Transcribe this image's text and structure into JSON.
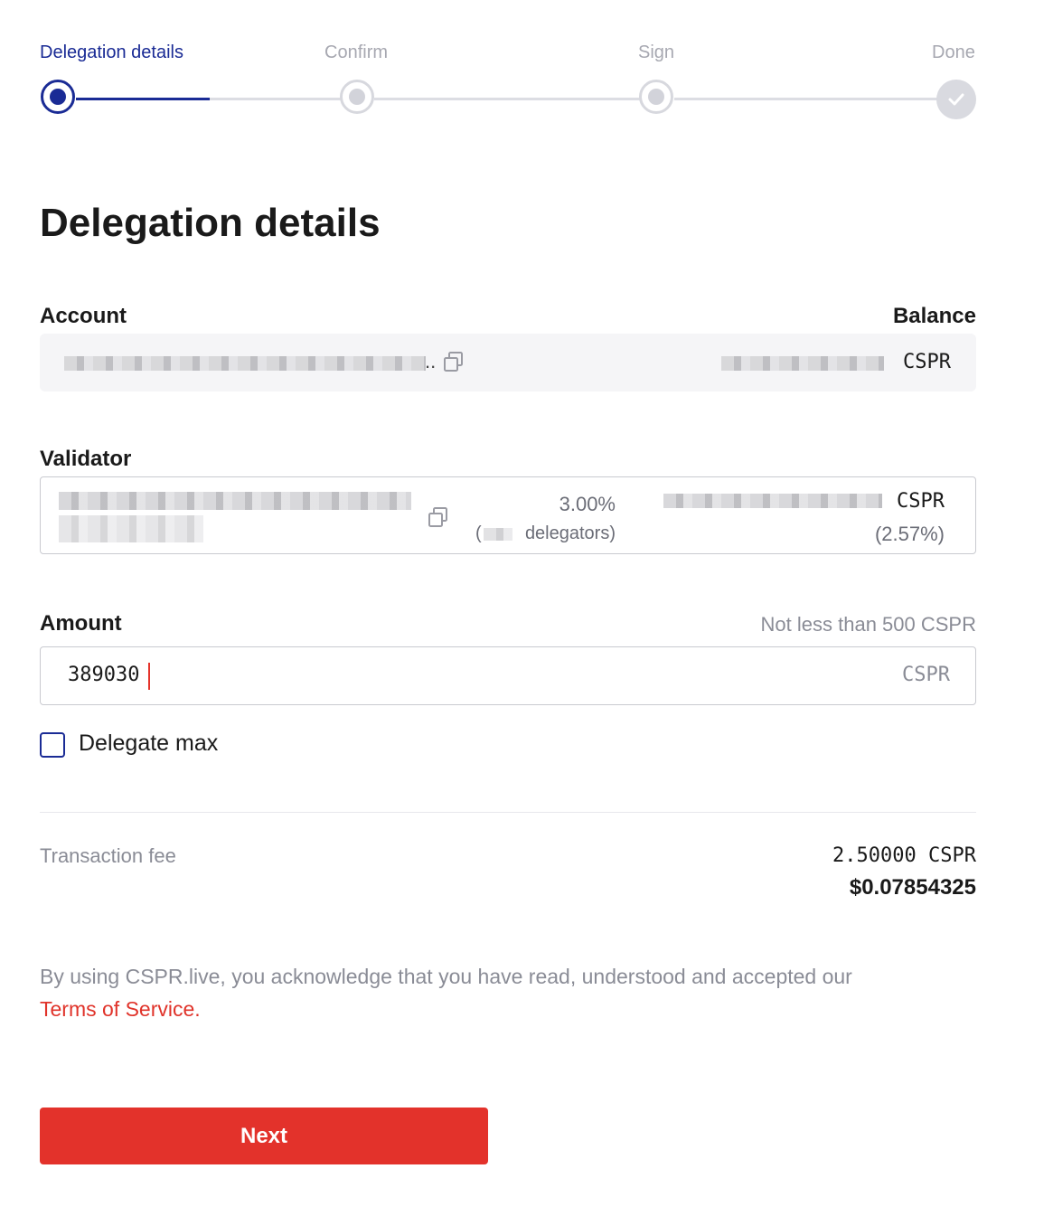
{
  "stepper": {
    "steps": [
      {
        "label": "Delegation details",
        "state": "current"
      },
      {
        "label": "Confirm",
        "state": "pending"
      },
      {
        "label": "Sign",
        "state": "pending"
      },
      {
        "label": "Done",
        "state": "pending"
      }
    ]
  },
  "page_title": "Delegation details",
  "account": {
    "label": "Account",
    "balance_label": "Balance",
    "address_suffix": "..",
    "balance_unit": "CSPR",
    "copy_icon": "copy-icon"
  },
  "validator": {
    "label": "Validator",
    "fee": "3.00%",
    "delegators_open": "(",
    "delegators_text": "delegators)",
    "stake_unit": "CSPR",
    "stake_share": "(2.57%)",
    "copy_icon": "copy-icon"
  },
  "amount": {
    "label": "Amount",
    "hint": "Not less than 500 CSPR",
    "value": "389030",
    "unit": "CSPR"
  },
  "delegate_max": {
    "label": "Delegate max",
    "checked": false
  },
  "fee": {
    "label": "Transaction fee",
    "cspr": "2.50000 CSPR",
    "usd": "$0.07854325"
  },
  "legal": {
    "text": "By using CSPR.live, you acknowledge that you have read, understood and accepted our",
    "link": "Terms of Service."
  },
  "next_button": "Next",
  "colors": {
    "primary": "#1a2b95",
    "accent": "#e3322b",
    "muted": "#8a8c96"
  }
}
